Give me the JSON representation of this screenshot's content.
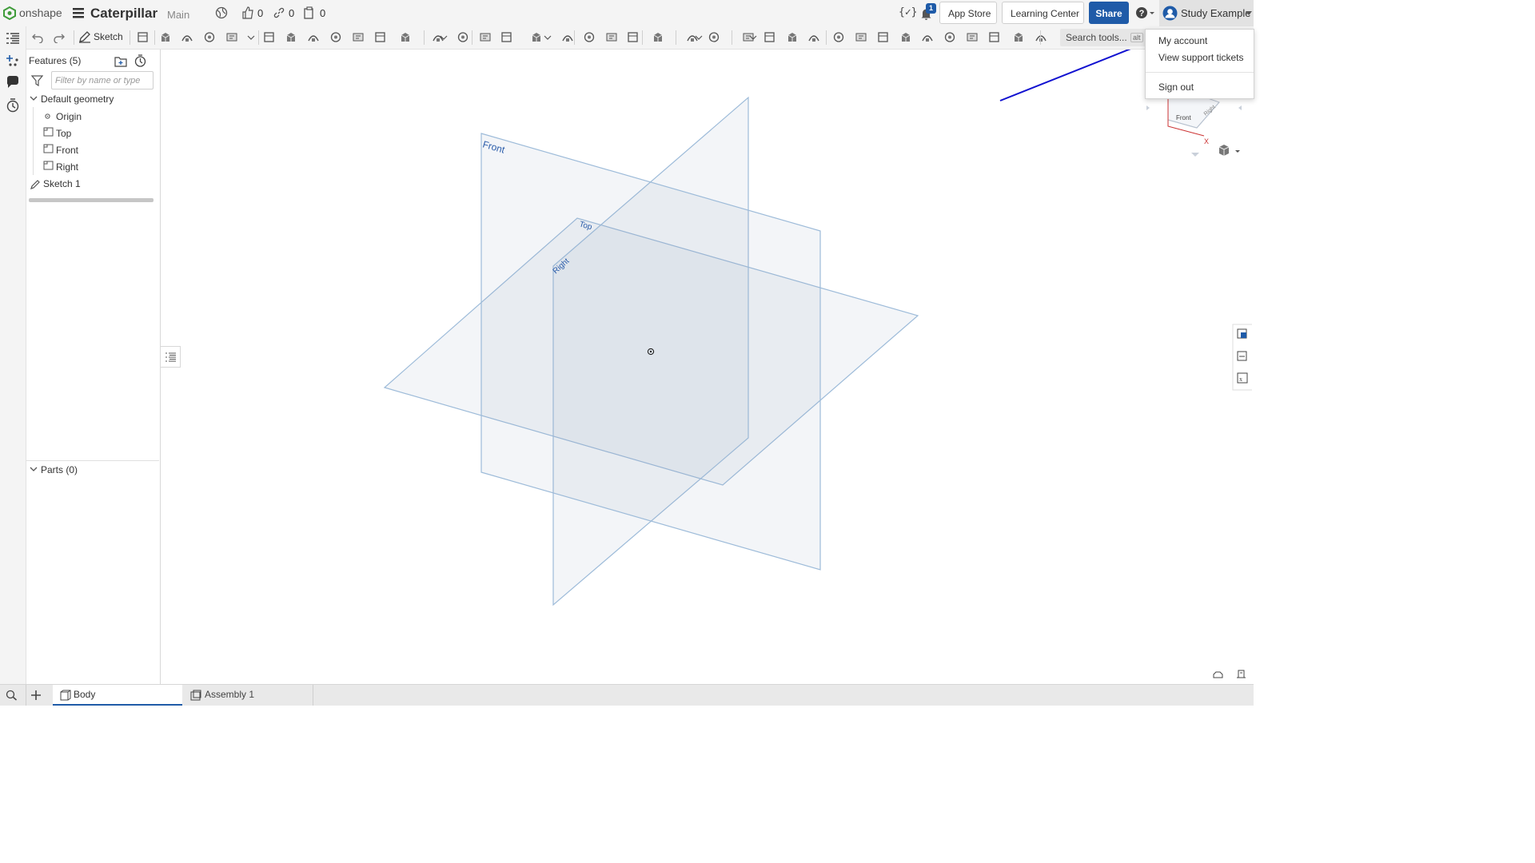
{
  "header": {
    "logo_text": "onshape",
    "doc_title": "Caterpillar",
    "branch": "Main",
    "likes": "0",
    "links": "0",
    "copies": "0",
    "notification_count": "1",
    "app_store": "App Store",
    "learning_center": "Learning Center",
    "share": "Share",
    "user_name": "Study Example"
  },
  "toolbar": {
    "sketch_label": "Sketch",
    "search_placeholder": "Search tools...",
    "search_shortcut": "alt"
  },
  "features": {
    "title": "Features (5)",
    "filter_placeholder": "Filter by name or type",
    "default_geometry": "Default geometry",
    "items": [
      "Origin",
      "Top",
      "Front",
      "Right"
    ],
    "sketch": "Sketch 1",
    "parts": "Parts (0)"
  },
  "viewport": {
    "plane_front": "Front",
    "plane_top": "Top",
    "plane_right": "Right",
    "cube_front": "Front",
    "cube_right": "Right",
    "axis_x": "X"
  },
  "user_menu": {
    "items": [
      "My account",
      "View support tickets",
      "Sign out"
    ]
  },
  "tabs": {
    "body": "Body",
    "assembly": "Assembly 1"
  },
  "colors": {
    "accent": "#1f5ba8",
    "plane_fill": "#e8eef5",
    "plane_stroke": "#9dbbd9",
    "annotation_arrow": "#1010d0"
  }
}
